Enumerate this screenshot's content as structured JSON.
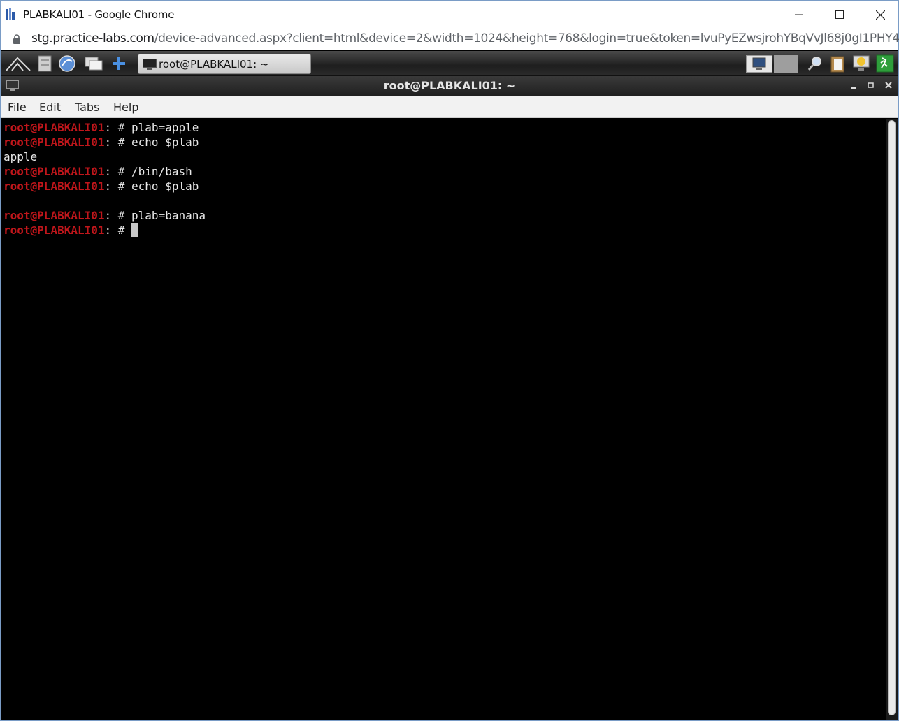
{
  "browser": {
    "window_title": "PLABKALI01 - Google Chrome",
    "url_host": "stg.practice-labs.com",
    "url_path": "/device-advanced.aspx?client=html&device=2&width=1024&height=768&login=true&token=lvuPyEZwsjrohYBqVvJl68j0gI1PHY4nyB1...",
    "controls": {
      "minimize": "minimize-icon",
      "maximize": "maximize-icon",
      "close": "close-icon"
    }
  },
  "kali_panel": {
    "task_label": "root@PLABKALI01: ~",
    "icons": [
      "kali-menu-icon",
      "file-manager-icon",
      "browser-icon",
      "show-desktop-icon",
      "add-icon",
      "monitor-icon",
      "search-icon",
      "clipboard-icon",
      "notification-icon",
      "logout-icon"
    ]
  },
  "terminal": {
    "title": "root@PLABKALI01: ~",
    "menu": [
      "File",
      "Edit",
      "Tabs",
      "Help"
    ],
    "prompt": "root@PLABKALI01",
    "prompt_suffix": ": # ",
    "lines": [
      {
        "type": "cmd",
        "text": "plab=apple"
      },
      {
        "type": "cmd",
        "text": "echo $plab"
      },
      {
        "type": "out",
        "text": "apple"
      },
      {
        "type": "cmd",
        "text": "/bin/bash"
      },
      {
        "type": "cmd",
        "text": "echo $plab"
      },
      {
        "type": "out",
        "text": ""
      },
      {
        "type": "cmd",
        "text": "plab=banana"
      },
      {
        "type": "cursor",
        "text": ""
      }
    ]
  },
  "colors": {
    "prompt": "#c0161b",
    "terminal_bg": "#000000",
    "terminal_fg": "#e8e8e8"
  }
}
